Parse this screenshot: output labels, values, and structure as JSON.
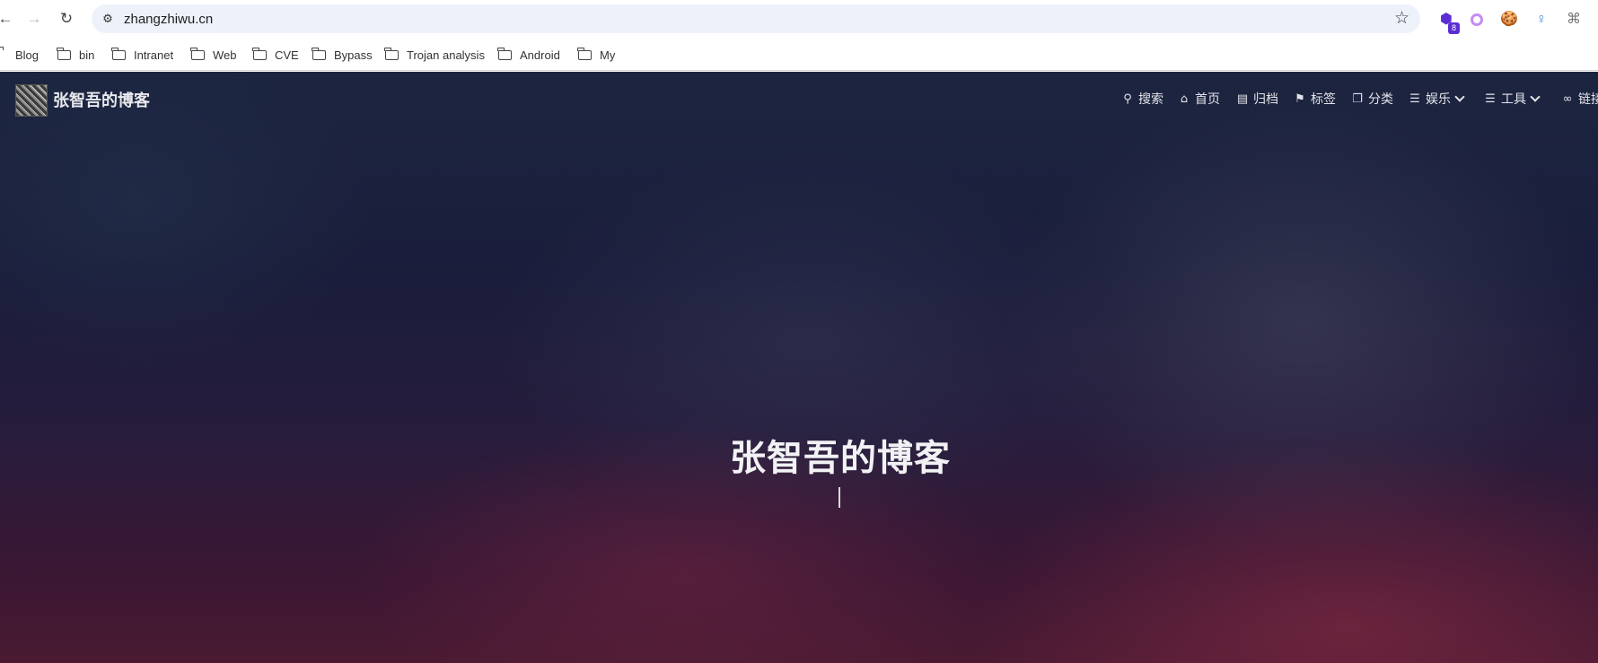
{
  "browser": {
    "url": "zhangzhiwu.cn",
    "nav": {
      "back_icon": "←",
      "forward_icon": "→",
      "reload_icon": "↻",
      "site_info_icon": "⚙",
      "star_icon": "☆"
    },
    "extensions": [
      {
        "name": "extension-blue-hex",
        "glyph": "⬢",
        "color": "#5b2ed4",
        "badge": "8"
      },
      {
        "name": "extension-purple-ring",
        "glyph": "",
        "color": "#c58cf0"
      },
      {
        "name": "extension-cookie",
        "glyph": "🍪",
        "color": "#8b5a2b"
      },
      {
        "name": "extension-pin",
        "glyph": "♀",
        "color": "#3b8ad9"
      },
      {
        "name": "extension-puzzle",
        "glyph": "⌘",
        "color": "#777777"
      }
    ]
  },
  "bookmarks": [
    "Blog",
    "bin",
    "Intranet",
    "Web",
    "CVE",
    "Bypass",
    "Trojan analysis",
    "Android",
    "My"
  ],
  "site": {
    "brand": "张智吾的博客",
    "menu": [
      {
        "label": "搜索",
        "icon": "⚲"
      },
      {
        "label": "首页",
        "icon": "⌂"
      },
      {
        "label": "归档",
        "icon": "▤"
      },
      {
        "label": "标签",
        "icon": "⚑"
      },
      {
        "label": "分类",
        "icon": "❐"
      },
      {
        "label": "娱乐",
        "icon": "☰",
        "dropdown": true
      },
      {
        "label": "工具",
        "icon": "☰",
        "dropdown": true
      },
      {
        "label": "链接",
        "icon": "∞"
      }
    ],
    "hero_title": "张智吾的博客"
  }
}
